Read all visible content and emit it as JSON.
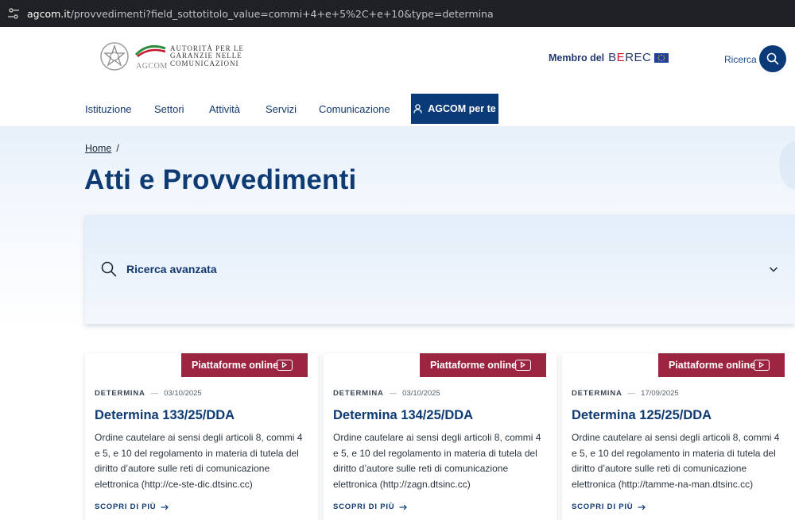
{
  "browser": {
    "url_host": "agcom.it",
    "url_rest": "/provvedimenti?field_sottotitolo_value=commi+4+e+5%2C+e+10&type=determina"
  },
  "header": {
    "logo": {
      "acronym": "AGCOM",
      "line1": "AUTORITÀ PER LE",
      "line2": "GARANZIE NELLE",
      "line3": "COMUNICAZIONI"
    },
    "berec_label": "Membro del",
    "berec_brand_b": "B",
    "berec_brand_e": "E",
    "berec_brand_rest": "REC",
    "search_label": "Ricerca"
  },
  "nav": {
    "items": [
      "Istituzione",
      "Settori",
      "Attività",
      "Servizi",
      "Comunicazione"
    ],
    "cta_label": "AGCOM per te"
  },
  "breadcrumb": {
    "home": "Home",
    "separator": "/"
  },
  "page_title": "Atti e Provvedimenti",
  "advanced_search": {
    "label": "Ricerca avanzata"
  },
  "cards": [
    {
      "tag": "Piattaforme online",
      "type": "DETERMINA",
      "date": "03/10/2025",
      "title": "Determina 133/25/DDA",
      "description": "Ordine cautelare ai sensi degli articoli 8, commi 4 e 5, e 10 del regolamento in materia di tutela del diritto d’autore sulle reti di comunicazione elettronica (http://ce-ste-dic.dtsinc.cc)",
      "more": "SCOPRI DI PIÙ"
    },
    {
      "tag": "Piattaforme online",
      "type": "DETERMINA",
      "date": "03/10/2025",
      "title": "Determina 134/25/DDA",
      "description": "Ordine cautelare ai sensi degli articoli 8, commi 4 e 5, e 10 del regolamento in materia di tutela del diritto d’autore sulle reti di comunicazione elettronica (http://zagn.dtsinc.cc)",
      "more": "SCOPRI DI PIÙ"
    },
    {
      "tag": "Piattaforme online",
      "type": "DETERMINA",
      "date": "17/09/2025",
      "title": "Determina 125/25/DDA",
      "description": "Ordine cautelare ai sensi degli articoli 8, commi 4 e 5, e 10 del regolamento in materia di tutela del diritto d’autore sulle reti di comunicazione elettronica (http://tamme-na-man.dtsinc.cc)",
      "more": "SCOPRI DI PIÙ"
    }
  ],
  "colors": {
    "primary": "#0b3a78",
    "title": "#0e3b74",
    "tag": "#9b2441",
    "berec_red": "#c4172c"
  }
}
